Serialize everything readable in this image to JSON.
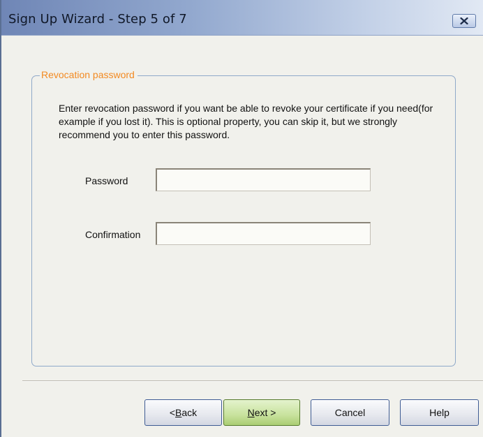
{
  "window": {
    "title": "Sign Up Wizard - Step 5 of 7"
  },
  "group": {
    "legend": "Revocation password",
    "description": "Enter revocation password if you want be able to revoke your certificate if you need(for example if you lost it). This is optional property, you can skip it, but we strongly recommend you to enter this password."
  },
  "fields": {
    "password_label": "Password",
    "password_value": "",
    "confirmation_label": "Confirmation",
    "confirmation_value": ""
  },
  "buttons": {
    "back_prefix": "< ",
    "back_mnemonic": "B",
    "back_rest": "ack",
    "next_mnemonic": "N",
    "next_rest": "ext >",
    "cancel": "Cancel",
    "help": "Help"
  },
  "colors": {
    "title_gradient_start": "#6f86b6",
    "legend_text": "#f28a22",
    "next_button": "#c8e29d",
    "group_border": "#8fa9c9"
  },
  "icons": {
    "close": "close-icon"
  }
}
